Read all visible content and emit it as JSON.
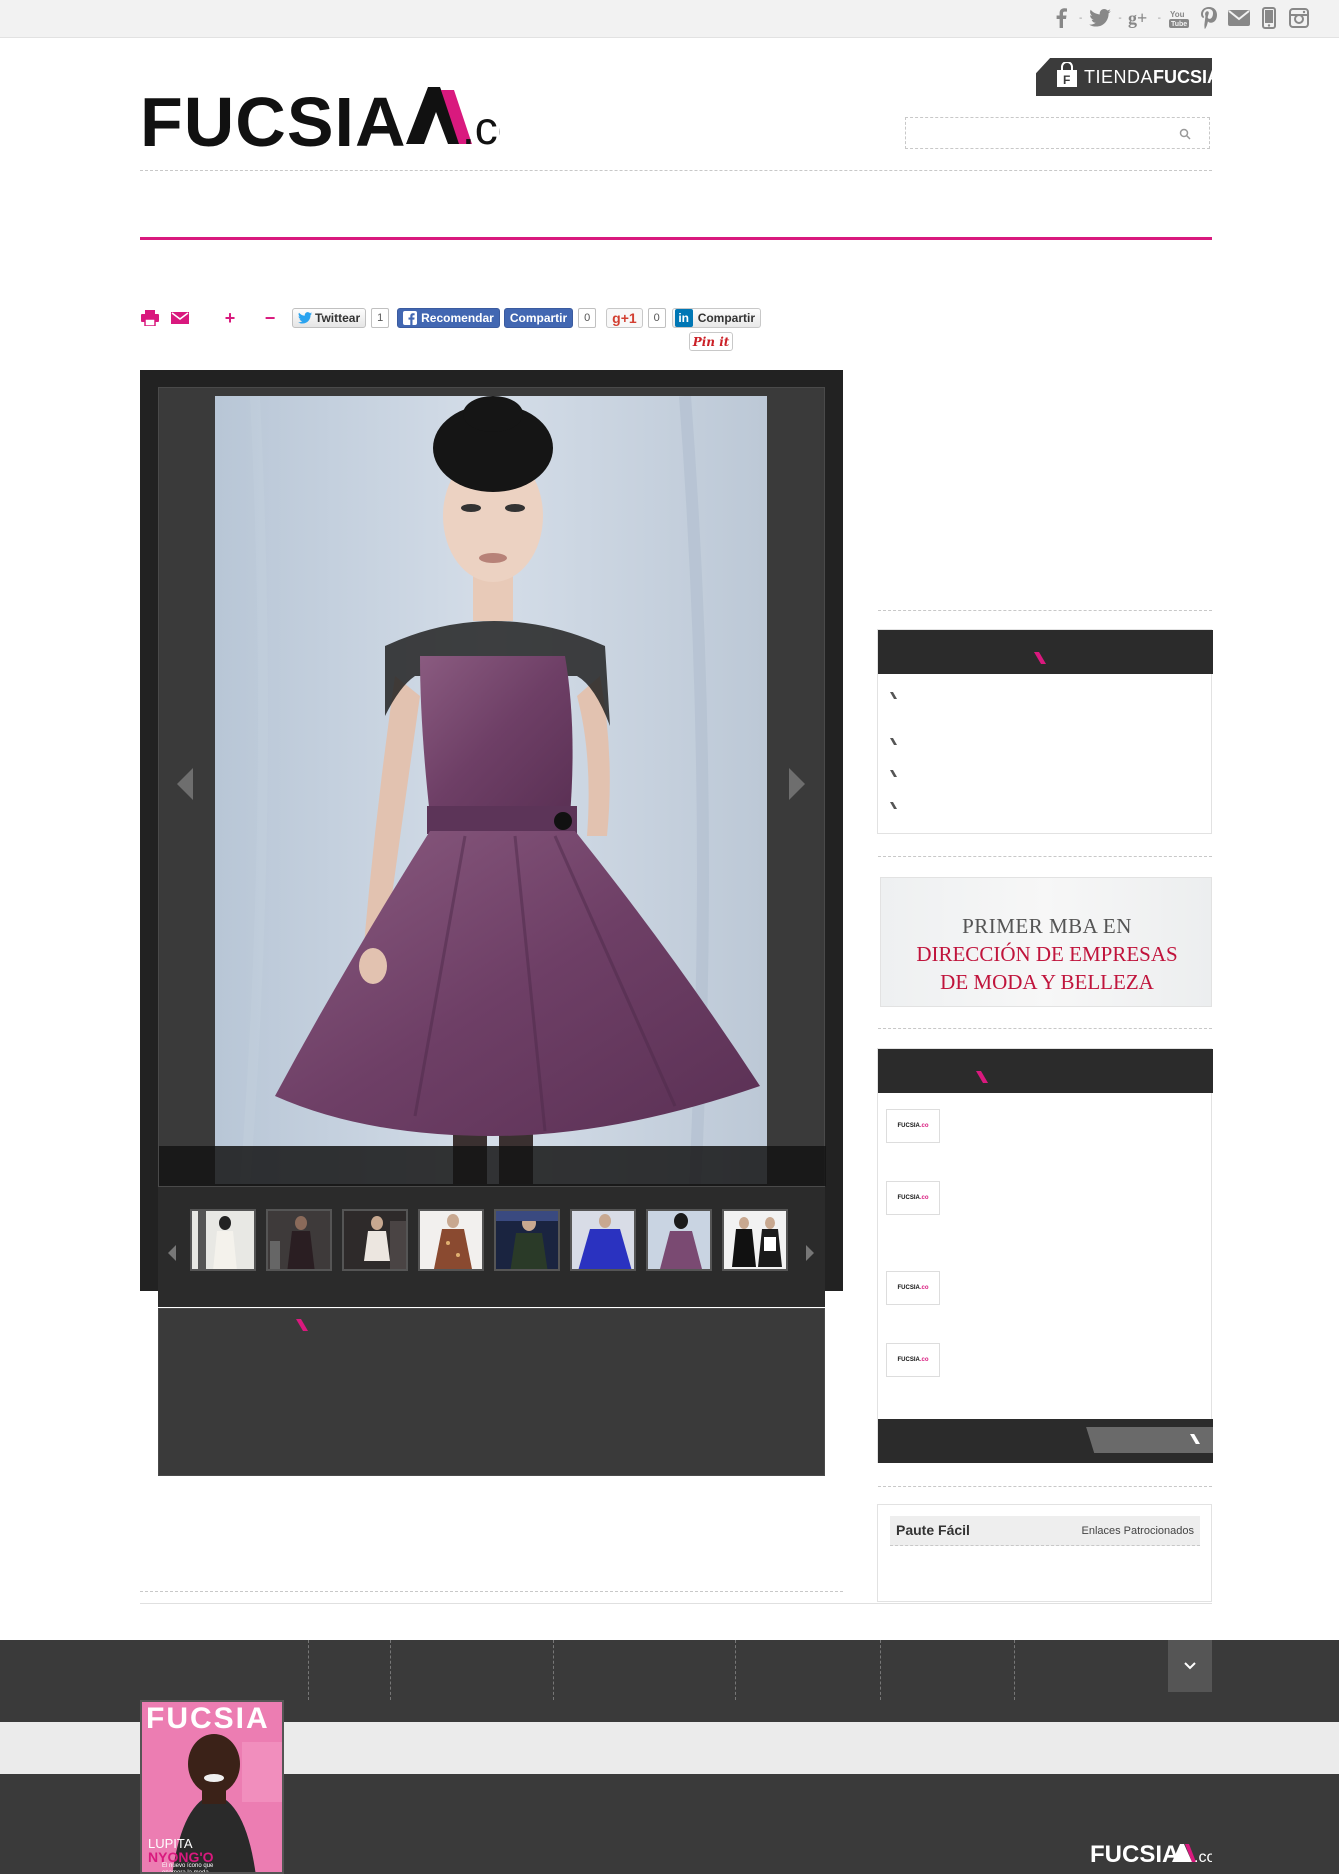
{
  "colors": {
    "brand_pink": "#d9197e",
    "dark": "#222222",
    "panel": "#3a3a3a",
    "facebook_blue": "#4267b2"
  },
  "topbar": {
    "icons": [
      "facebook-icon",
      "twitter-icon",
      "google-plus-icon",
      "youtube-icon",
      "pinterest-icon",
      "mail-icon",
      "mobile-icon",
      "instagram-icon"
    ]
  },
  "header": {
    "logo_main": "FUCSIA",
    "logo_suffix": ".co",
    "tienda_part1": "TIENDA",
    "tienda_part2": "FUCSIA",
    "search_placeholder": ""
  },
  "share": {
    "tweet_label": "Twittear",
    "tweet_count": "1",
    "fb_recommend_label": "Recomendar",
    "fb_share_label": "Compartir",
    "fb_count": "0",
    "gplus_label": "g+1",
    "gplus_count": "0",
    "linkedin_logo": "in",
    "linkedin_label": "Compartir",
    "pinit_label": "Pin it",
    "plus_label": "+",
    "minus_label": "−"
  },
  "sidebar": {
    "paute_title": "Paute Fácil",
    "paute_subtitle": "Enlaces Patrocionados",
    "mba_line1": "PRIMER MBA EN",
    "mba_line2": "DIRECCIÓN DE EMPRESAS",
    "mba_line3": "DE MODA Y BELLEZA",
    "mini_logo_main": "FUCSIA",
    "mini_logo_suffix": ".co"
  },
  "footer": {
    "cover_title": "FUCSIA",
    "cover_name1": "LUPITA",
    "cover_name2": "NYONG'O",
    "cover_tagline": "El nuevo ícono que enamora la moda",
    "logo_main": "FUCSIA",
    "logo_suffix": ".co"
  }
}
